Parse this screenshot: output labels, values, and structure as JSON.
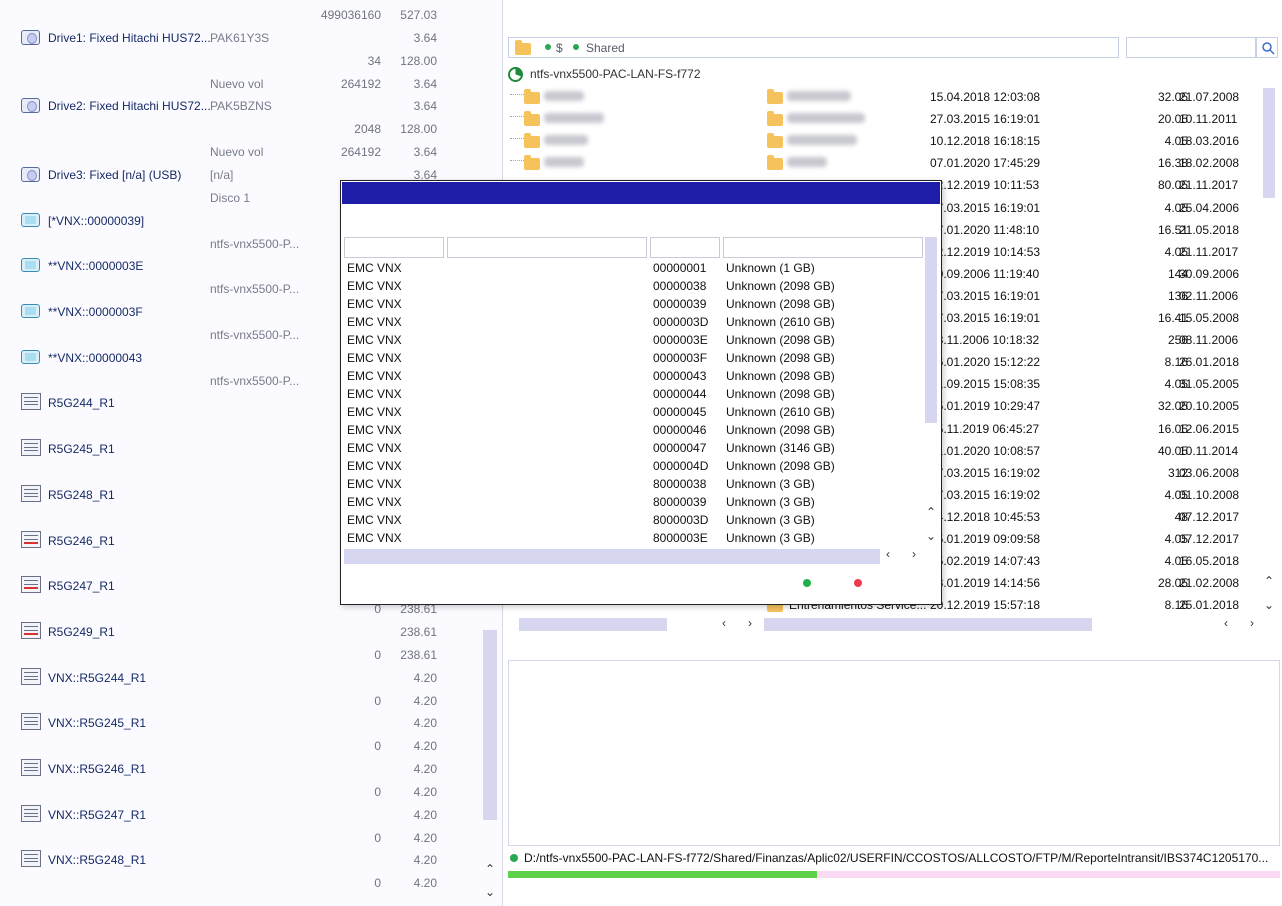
{
  "left_panel": {
    "rows": [
      {
        "icon": "none",
        "name": "",
        "sub": "",
        "v1": "499036160",
        "v2": "527.03"
      },
      {
        "icon": "drive",
        "name": "Drive1: Fixed Hitachi HUS72...",
        "sub": "PAK61Y3S",
        "v1": "",
        "v2": "3.64"
      },
      {
        "icon": "none",
        "name": "",
        "sub": "",
        "v1": "34",
        "v2": "128.00"
      },
      {
        "icon": "none",
        "name": "",
        "sub": "Nuevo vol",
        "v1": "264192",
        "v2": "3.64"
      },
      {
        "icon": "drive",
        "name": "Drive2: Fixed Hitachi HUS72...",
        "sub": "PAK5BZNS",
        "v1": "",
        "v2": "3.64"
      },
      {
        "icon": "none",
        "name": "",
        "sub": "",
        "v1": "2048",
        "v2": "128.00"
      },
      {
        "icon": "none",
        "name": "",
        "sub": "Nuevo vol",
        "v1": "264192",
        "v2": "3.64"
      },
      {
        "icon": "drive",
        "name": "Drive3: Fixed [n/a] (USB)",
        "sub": "[n/a]",
        "v1": "",
        "v2": "3.64"
      },
      {
        "icon": "none",
        "name": "",
        "sub": "Disco 1",
        "v1": "",
        "v2": ""
      },
      {
        "icon": "vol",
        "name": "[*VNX::00000039]",
        "sub": "",
        "v1": "",
        "v2": ""
      },
      {
        "icon": "none",
        "name": "",
        "sub": "ntfs-vnx5500-P...",
        "v1": "",
        "v2": ""
      },
      {
        "icon": "vol",
        "name": "**VNX::0000003E",
        "sub": "",
        "v1": "",
        "v2": ""
      },
      {
        "icon": "none",
        "name": "",
        "sub": "ntfs-vnx5500-P...",
        "v1": "",
        "v2": ""
      },
      {
        "icon": "vol",
        "name": "**VNX::0000003F",
        "sub": "",
        "v1": "",
        "v2": ""
      },
      {
        "icon": "none",
        "name": "",
        "sub": "ntfs-vnx5500-P...",
        "v1": "",
        "v2": ""
      },
      {
        "icon": "vol",
        "name": "**VNX::00000043",
        "sub": "",
        "v1": "",
        "v2": ""
      },
      {
        "icon": "none",
        "name": "",
        "sub": "ntfs-vnx5500-P...",
        "v1": "",
        "v2": ""
      },
      {
        "icon": "srv",
        "name": "R5G244_R1",
        "sub": "",
        "v1": "",
        "v2": ""
      },
      {
        "icon": "none",
        "name": "",
        "sub": "",
        "v1": "",
        "v2": ""
      },
      {
        "icon": "srv",
        "name": "R5G245_R1",
        "sub": "",
        "v1": "",
        "v2": ""
      },
      {
        "icon": "none",
        "name": "",
        "sub": "",
        "v1": "",
        "v2": ""
      },
      {
        "icon": "srv",
        "name": "R5G248_R1",
        "sub": "",
        "v1": "",
        "v2": ""
      },
      {
        "icon": "none",
        "name": "",
        "sub": "",
        "v1": "",
        "v2": ""
      },
      {
        "icon": "srv-alert",
        "name": "R5G246_R1",
        "sub": "",
        "v1": "",
        "v2": ""
      },
      {
        "icon": "none",
        "name": "",
        "sub": "",
        "v1": "",
        "v2": ""
      },
      {
        "icon": "srv-alert",
        "name": "R5G247_R1",
        "sub": "",
        "v1": "",
        "v2": ""
      },
      {
        "icon": "none",
        "name": "",
        "sub": "",
        "v1": "0",
        "v2": "238.61"
      },
      {
        "icon": "srv-alert",
        "name": "R5G249_R1",
        "sub": "",
        "v1": "",
        "v2": "238.61"
      },
      {
        "icon": "none",
        "name": "",
        "sub": "",
        "v1": "0",
        "v2": "238.61"
      },
      {
        "icon": "srv",
        "name": "VNX::R5G244_R1",
        "sub": "",
        "v1": "",
        "v2": "4.20"
      },
      {
        "icon": "none",
        "name": "",
        "sub": "",
        "v1": "0",
        "v2": "4.20"
      },
      {
        "icon": "srv",
        "name": "VNX::R5G245_R1",
        "sub": "",
        "v1": "",
        "v2": "4.20"
      },
      {
        "icon": "none",
        "name": "",
        "sub": "",
        "v1": "0",
        "v2": "4.20"
      },
      {
        "icon": "srv",
        "name": "VNX::R5G246_R1",
        "sub": "",
        "v1": "",
        "v2": "4.20"
      },
      {
        "icon": "none",
        "name": "",
        "sub": "",
        "v1": "0",
        "v2": "4.20"
      },
      {
        "icon": "srv",
        "name": "VNX::R5G247_R1",
        "sub": "",
        "v1": "",
        "v2": "4.20"
      },
      {
        "icon": "none",
        "name": "",
        "sub": "",
        "v1": "0",
        "v2": "4.20"
      },
      {
        "icon": "srv",
        "name": "VNX::R5G248_R1",
        "sub": "",
        "v1": "",
        "v2": "4.20"
      },
      {
        "icon": "none",
        "name": "",
        "sub": "",
        "v1": "0",
        "v2": "4.20"
      }
    ]
  },
  "right_panel": {
    "breadcrumb": {
      "part1": "$",
      "part2": "Shared"
    },
    "search_value": "",
    "server_name": "ntfs-vnx5500-PAC-LAN-FS-f772",
    "files": [
      {
        "date1": "15.04.2018 12:03:08",
        "size": "32.05",
        "date2": "21.07.2008"
      },
      {
        "date1": "27.03.2015 16:19:01",
        "size": "20.05",
        "date2": "10.11.2011"
      },
      {
        "date1": "10.12.2018 16:18:15",
        "size": "4.05",
        "date2": "18.03.2016"
      },
      {
        "date1": "07.01.2020 17:45:29",
        "size": "16.38",
        "date2": "18.02.2008"
      },
      {
        "date1": "12.12.2019 10:11:53",
        "size": "80.05",
        "date2": "21.11.2017"
      },
      {
        "date1": "27.03.2015 16:19:01",
        "size": "4.05",
        "date2": "25.04.2006"
      },
      {
        "date1": "07.01.2020 11:48:10",
        "size": "16.51",
        "date2": "21.05.2018"
      },
      {
        "date1": "12.12.2019 10:14:53",
        "size": "4.05",
        "date2": "21.11.2017"
      },
      {
        "date1": "30.09.2006 11:19:40",
        "size": "144",
        "date2": "30.09.2006"
      },
      {
        "date1": "27.03.2015 16:19:01",
        "size": "136",
        "date2": "02.11.2006"
      },
      {
        "date1": "27.03.2015 16:19:01",
        "size": "16.41",
        "date2": "15.05.2008"
      },
      {
        "date1": "08.11.2006 10:18:32",
        "size": "256",
        "date2": "08.11.2006"
      },
      {
        "date1": "16.01.2020 15:12:22",
        "size": "8.16",
        "date2": "26.01.2018"
      },
      {
        "date1": "01.09.2015 15:08:35",
        "size": "4.05",
        "date2": "31.05.2005"
      },
      {
        "date1": "15.01.2019 10:29:47",
        "size": "32.05",
        "date2": "20.10.2005"
      },
      {
        "date1": "15.11.2019 06:45:27",
        "size": "16.05",
        "date2": "12.06.2015"
      },
      {
        "date1": "21.01.2020 10:08:57",
        "size": "40.05",
        "date2": "10.11.2014"
      },
      {
        "date1": "27.03.2015 16:19:02",
        "size": "312",
        "date2": "03.06.2008"
      },
      {
        "date1": "27.03.2015 16:19:02",
        "size": "4.05",
        "date2": "01.10.2008"
      },
      {
        "date1": "04.12.2018 10:45:53",
        "size": "48",
        "date2": "07.12.2017"
      },
      {
        "date1": "15.01.2019 09:09:58",
        "size": "4.05",
        "date2": "07.12.2017"
      },
      {
        "date1": "05.02.2019 14:07:43",
        "size": "4.05",
        "date2": "16.05.2018"
      },
      {
        "date1": "23.01.2019 14:14:56",
        "size": "28.05",
        "date2": "21.02.2008"
      },
      {
        "date1": "20.12.2019 15:57:18",
        "size": "8.16",
        "date2": "25.01.2018"
      }
    ],
    "last_folder_label": "Entrenamientos Service...",
    "status_path": "D:/ntfs-vnx5500-PAC-LAN-FS-f772/Shared/Finanzas/Aplic02/USERFIN/CCOSTOS/ALLCOSTO/FTP/M/ReporteIntransit/IBS374C1205170...",
    "progress_fraction": 0.4
  },
  "dialog": {
    "rows": [
      {
        "vendor": "EMC VNX",
        "id": "00000001",
        "desc": "Unknown (1 GB)"
      },
      {
        "vendor": "EMC VNX",
        "id": "00000038",
        "desc": "Unknown (2098 GB)"
      },
      {
        "vendor": "EMC VNX",
        "id": "00000039",
        "desc": "Unknown (2098 GB)"
      },
      {
        "vendor": "EMC VNX",
        "id": "0000003D",
        "desc": "Unknown (2610 GB)"
      },
      {
        "vendor": "EMC VNX",
        "id": "0000003E",
        "desc": "Unknown (2098 GB)"
      },
      {
        "vendor": "EMC VNX",
        "id": "0000003F",
        "desc": "Unknown (2098 GB)"
      },
      {
        "vendor": "EMC VNX",
        "id": "00000043",
        "desc": "Unknown (2098 GB)"
      },
      {
        "vendor": "EMC VNX",
        "id": "00000044",
        "desc": "Unknown (2098 GB)"
      },
      {
        "vendor": "EMC VNX",
        "id": "00000045",
        "desc": "Unknown (2610 GB)"
      },
      {
        "vendor": "EMC VNX",
        "id": "00000046",
        "desc": "Unknown (2098 GB)"
      },
      {
        "vendor": "EMC VNX",
        "id": "00000047",
        "desc": "Unknown (3146 GB)"
      },
      {
        "vendor": "EMC VNX",
        "id": "0000004D",
        "desc": "Unknown (2098 GB)"
      },
      {
        "vendor": "EMC VNX",
        "id": "80000038",
        "desc": "Unknown (3 GB)"
      },
      {
        "vendor": "EMC VNX",
        "id": "80000039",
        "desc": "Unknown (3 GB)"
      },
      {
        "vendor": "EMC VNX",
        "id": "8000003D",
        "desc": "Unknown (3 GB)"
      },
      {
        "vendor": "EMC VNX",
        "id": "8000003E",
        "desc": "Unknown (3 GB)"
      }
    ],
    "ok_color": "#22b04a",
    "cancel_color": "#ee3a4a",
    "title_color": "#1d1da8"
  },
  "icons": {
    "scroll_up": "⌃",
    "scroll_down": "⌄",
    "scroll_left": "‹",
    "scroll_right": "›"
  }
}
